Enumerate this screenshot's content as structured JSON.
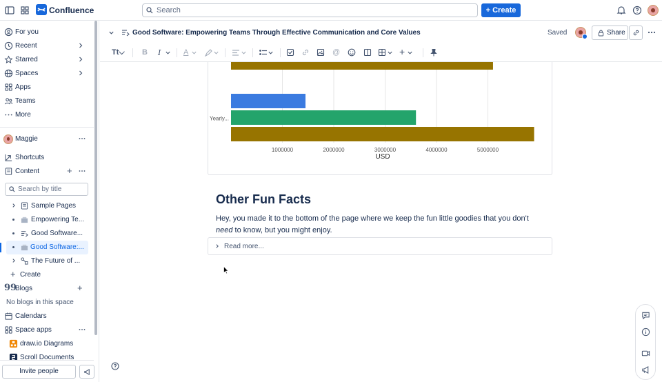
{
  "topbar": {
    "app_name": "Confluence",
    "search_placeholder": "Search",
    "create_label": "Create"
  },
  "sidebar": {
    "nav": [
      {
        "label": "For you",
        "icon": "user-circle-icon"
      },
      {
        "label": "Recent",
        "icon": "clock-icon"
      },
      {
        "label": "Starred",
        "icon": "star-icon"
      },
      {
        "label": "Spaces",
        "icon": "globe-icon"
      },
      {
        "label": "Apps",
        "icon": "apps-grid-icon"
      },
      {
        "label": "Teams",
        "icon": "people-icon"
      },
      {
        "label": "More",
        "icon": "more-dots-icon"
      }
    ],
    "space_name": "Maggie",
    "shortcuts_label": "Shortcuts",
    "content_label": "Content",
    "search_placeholder": "Search by title",
    "tree": [
      {
        "label": "Sample Pages",
        "type": "folder"
      },
      {
        "label": "Empowering Te...",
        "type": "whiteboard"
      },
      {
        "label": "Good Software...",
        "type": "page"
      },
      {
        "label": "Good Software:...",
        "type": "whiteboard",
        "active": true
      },
      {
        "label": "The Future of ...",
        "type": "diagram"
      }
    ],
    "tree_create_label": "Create",
    "blogs_label": "Blogs",
    "no_blogs_text": "No blogs in this space",
    "calendars_label": "Calendars",
    "space_apps_label": "Space apps",
    "apps": [
      {
        "label": "draw.io Diagrams"
      },
      {
        "label": "Scroll Documents"
      }
    ],
    "invite_label": "Invite people"
  },
  "page": {
    "title": "Good Software: Empowering Teams Through Effective Communication and Core Values",
    "saved_label": "Saved",
    "share_label": "Share"
  },
  "chart_data": {
    "type": "bar",
    "orientation": "horizontal",
    "categories": [
      "",
      "Yearly..."
    ],
    "series": [
      {
        "color": "#3b7be0",
        "values": [
          null,
          1450000
        ]
      },
      {
        "color": "#24a46b",
        "values": [
          null,
          3600000
        ]
      },
      {
        "color": "#977400",
        "values": [
          5100000,
          5900000
        ]
      }
    ],
    "xlabel": "USD",
    "xticks": [
      "1000000",
      "2000000",
      "3000000",
      "4000000",
      "5000000"
    ],
    "xlim": [
      0,
      6000000
    ]
  },
  "section": {
    "heading": "Other Fun Facts",
    "paragraph_before": "Hey, you made it to the bottom of the page where we keep the fun little goodies that you don't ",
    "paragraph_em": "need",
    "paragraph_after": " to know, but you might enjoy.",
    "expand_label": "Read more..."
  }
}
